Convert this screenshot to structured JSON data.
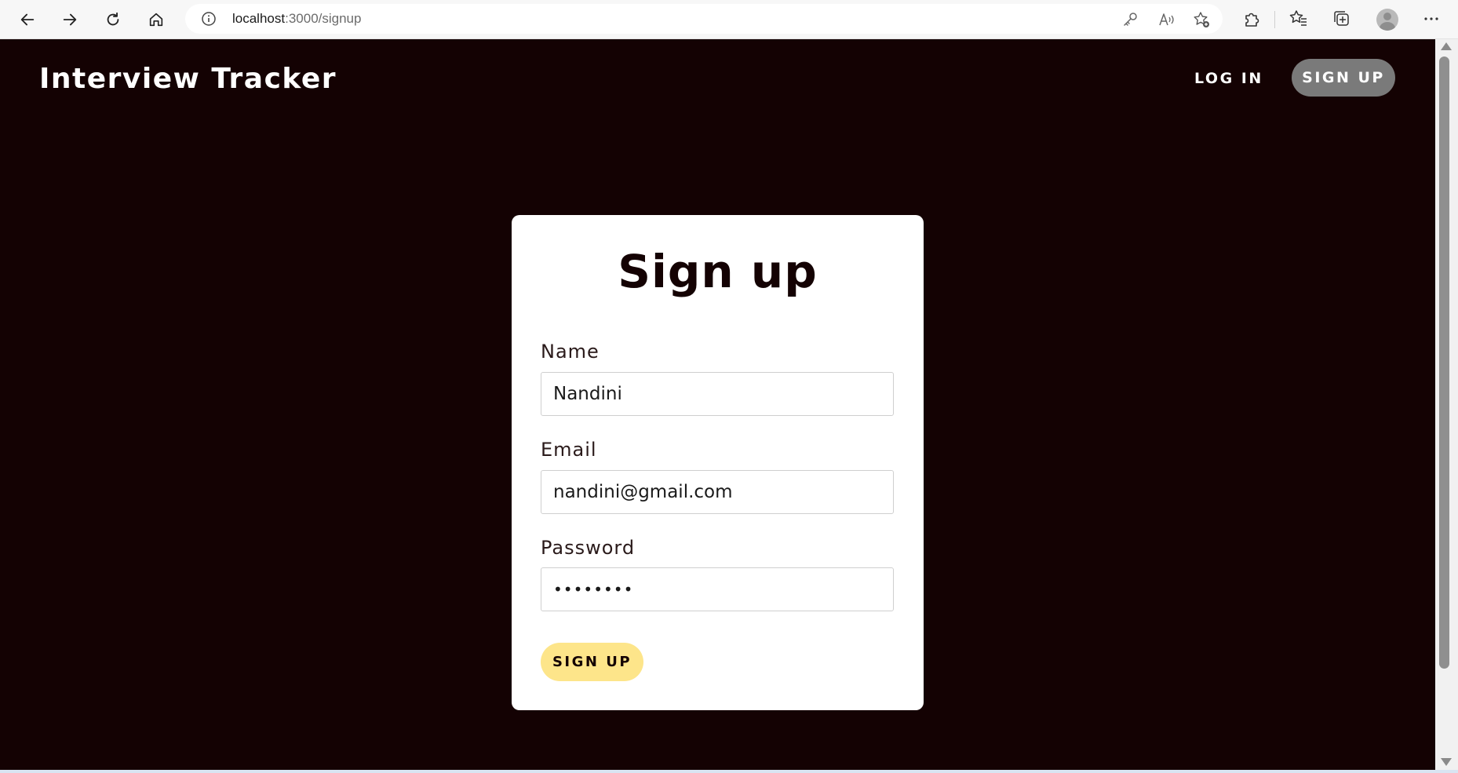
{
  "browser": {
    "url_host": "localhost",
    "url_path": ":3000/signup",
    "icons": {
      "back": "back-arrow-icon",
      "forward": "forward-arrow-icon",
      "refresh": "refresh-icon",
      "home": "home-icon",
      "site_info": "info-icon",
      "password": "key-icon",
      "read_aloud": "read-aloud-icon",
      "add_favorite": "star-add-icon",
      "extensions": "puzzle-icon",
      "favorites": "favorites-icon",
      "collections": "collections-icon",
      "profile": "profile-icon",
      "more": "more-icon"
    }
  },
  "navbar": {
    "brand": "Interview Tracker",
    "login_label": "LOG IN",
    "signup_label": "SIGN UP"
  },
  "form": {
    "title": "Sign up",
    "name_label": "Name",
    "name_value": "Nandini",
    "email_label": "Email",
    "email_value": "nandini@gmail.com",
    "password_label": "Password",
    "password_value": "••••••••",
    "submit_label": "SIGN UP"
  },
  "colors": {
    "page_background": "#140203",
    "card_background": "#ffffff",
    "signup_nav_button": "#7a7a7a",
    "submit_button": "#fde58a"
  }
}
